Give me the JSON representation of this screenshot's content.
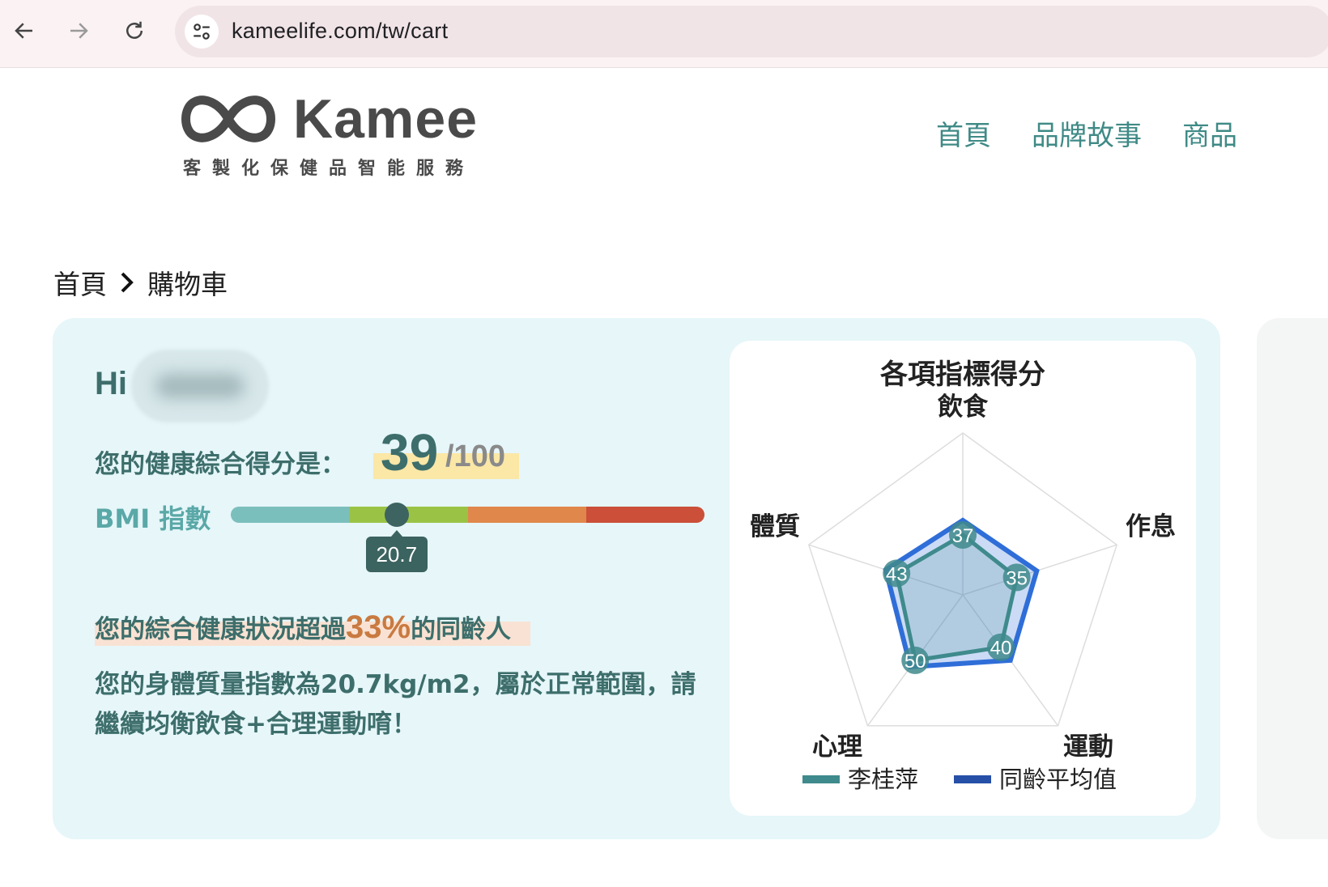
{
  "browser": {
    "url": "kameelife.com/tw/cart"
  },
  "site": {
    "logo_word": "Kamee",
    "logo_tagline": "客製化保健品智能服務",
    "nav": [
      "首頁",
      "品牌故事",
      "商品"
    ]
  },
  "breadcrumb": {
    "home": "首頁",
    "current": "購物車"
  },
  "summary": {
    "greeting": "Hi",
    "score_label": "您的健康綜合得分是：",
    "score": "39",
    "score_max": "/100",
    "bmi_label": "BMI 指數",
    "bmi_value": "20.7",
    "bmi_position": 0.35,
    "bmi_colors": [
      "#7bbfbd",
      "#9ac345",
      "#e0874b",
      "#cb4f39"
    ],
    "compare_prefix": "您的綜合健康狀況超過",
    "compare_pct": "33%",
    "compare_suffix": "的同齡人",
    "advice": "您的身體質量指數為20.7kg/m2，屬於正常範圍，請繼續均衡飲食+合理運動唷！"
  },
  "chart_data": {
    "type": "radar",
    "title": "各項指標得分",
    "axes": [
      "飲食",
      "作息",
      "運動",
      "心理",
      "體質"
    ],
    "rmax": 100,
    "series": [
      {
        "name": "李桂萍",
        "values": [
          37,
          35,
          40,
          50,
          43
        ],
        "color": "#3f8a8c"
      },
      {
        "name": "同齡平均值",
        "values": [
          46,
          48,
          50,
          55,
          50
        ],
        "color": "#2f6ed8"
      }
    ],
    "data_labels": [
      "37",
      "35",
      "40",
      "50",
      "43"
    ]
  }
}
